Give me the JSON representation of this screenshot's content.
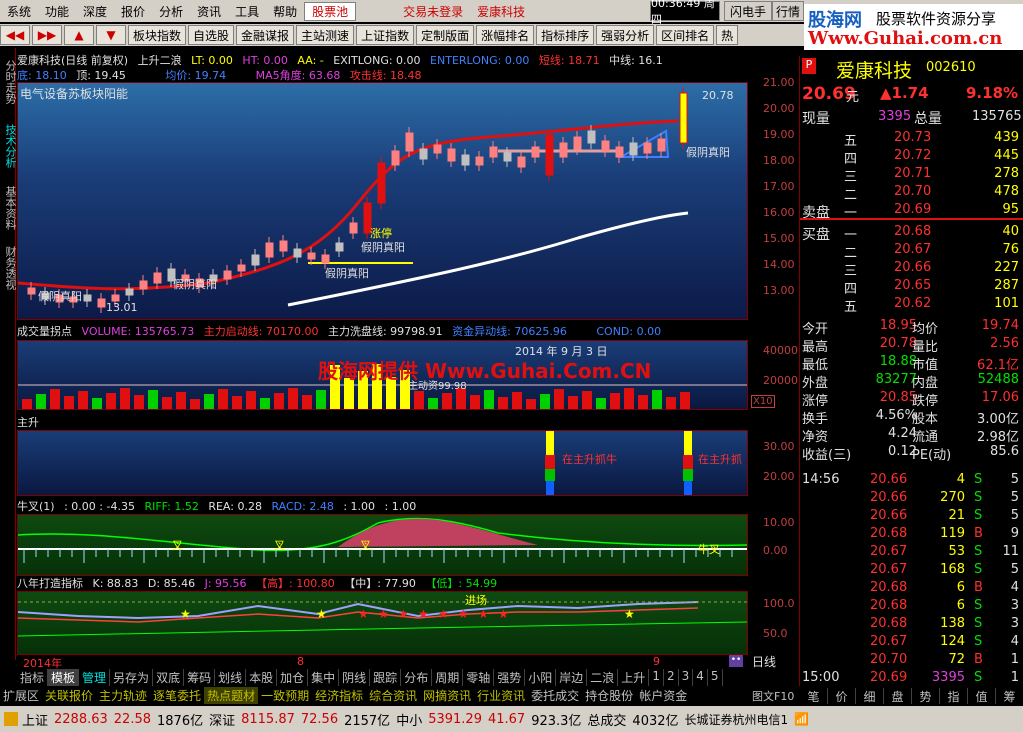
{
  "menu": [
    "系统",
    "功能",
    "深度",
    "报价",
    "分析",
    "资讯",
    "工具",
    "帮助"
  ],
  "menu_pool": "股票池",
  "menu_notice": "交易未登录",
  "menu_stock": "爱康科技",
  "clock": "00:36:49 周四",
  "flash_btn": "闪电手",
  "quote_btn": "行情",
  "logo": {
    "t1": "股海网",
    "t2": "股票软件资源分享",
    "t3": "Www.Guhai.com.cn"
  },
  "toolbar": [
    "板块指数",
    "自选股",
    "金融谋报",
    "主站测速",
    "上证指数",
    "定制版面",
    "涨幅排名",
    "指标排序",
    "强弱分析",
    "区间排名",
    "热"
  ],
  "side_tabs": [
    "分时走势",
    "技术分析",
    "基本资料",
    "财务透视"
  ],
  "main_header": {
    "title": "爱康科技(日线 前复权)",
    "f1": "上升二浪",
    "f2": "LT: 0.00",
    "f3": "HT: 0.00",
    "f4": "AA: -",
    "f5": "EXITLONG: 0.00",
    "f6": "ENTERLONG: 0.00",
    "f7": "短线: 18.71",
    "f8": "中线: 16.1"
  },
  "main_header2": {
    "low": "底: 18.10",
    "top": "顶: 19.45",
    "avg": "均价: 19.74",
    "ma5": "MA5角度: 63.68",
    "atk": "攻击线: 18.48"
  },
  "main_sub": "电气设备苏板块阳能",
  "main_labels": {
    "high": "20.78",
    "low": "13.01",
    "a1": "假阴真阳",
    "a2": "假阴真阳",
    "a3": "假阴真阳",
    "a4": "假阴真阳",
    "a5": "假阴真阳",
    "zt": "涨停"
  },
  "main_axis": [
    "21.00",
    "20.00",
    "19.00",
    "18.00",
    "17.00",
    "16.00",
    "15.00",
    "14.00",
    "13.00"
  ],
  "vol_header": {
    "name": "成交量拐点",
    "v1": "VOLUME: 135765.73",
    "v2": "主力启动线: 70170.00",
    "v3": "主力洗盘线: 99798.91",
    "v4": "资金异动线: 70625.96",
    "v5": "COND: 0.00"
  },
  "vol_axis": [
    "40000",
    "20000",
    "X10"
  ],
  "vol_watermark": "股海网提供 Www.Guhai.Com.CN",
  "vol_date": "2014 年 9 月 3 日",
  "vol_note": "主动资99.98",
  "zs_header": "主升",
  "zs_axis": [
    "30.00",
    "20.00"
  ],
  "zs_labels": [
    "在主升抓牛",
    "在主升抓"
  ],
  "nc_header": {
    "name": "牛叉(1)",
    "v1": ": 0.00 : -4.35",
    "v2": "RIFF: 1.52",
    "v3": "REA: 0.28",
    "v4": "RACD: 2.48",
    "v5": ": 1.00",
    "v6": ": 1.00"
  },
  "nc_axis": [
    "10.00",
    "0.00"
  ],
  "nc_labels": [
    "叉",
    "叉",
    "叉",
    "牛叉"
  ],
  "bn_header": {
    "name": "八年打造指标",
    "k": "K: 88.83",
    "d": "D: 85.46",
    "j": "J: 95.56",
    "g": "【高】: 100.80",
    "z": "【中】: 77.90",
    "l": "【低】: 54.99"
  },
  "bn_axis": [
    "100.0",
    "50.0"
  ],
  "bn_label": "进场",
  "timeline": {
    "y": "2014年",
    "m8": "8",
    "m9": "9"
  },
  "bottom_tabs": [
    "指标",
    "模板",
    "管理",
    "另存为",
    "双底",
    "筹码",
    "划线",
    "本股",
    "加仓",
    "集中",
    "阴线",
    "跟踪",
    "分布",
    "周期",
    "零轴",
    "强势",
    "小阳",
    "岸边",
    "二浪",
    "上升",
    "1",
    "2",
    "3",
    "4",
    "5"
  ],
  "day_btn": "日线",
  "info_tabs": [
    "扩展区",
    "关联报价",
    "主力轨迹",
    "逐笔委托",
    "热点题材",
    "一致预期",
    "经济指标",
    "综合资讯",
    "网摘资讯",
    "行业资讯",
    "委托成交",
    "持仓股份",
    "帐户资金"
  ],
  "right": {
    "code_flag": "P",
    "name": "爱康科技",
    "code": "002610",
    "price": "20.69",
    "unit": "元",
    "chg": "▲1.74",
    "pct": "9.18%",
    "now_lbl": "现量",
    "now_val": "3395",
    "total_lbl": "总量",
    "total_val": "135765",
    "sell": [
      {
        "l": "五",
        "p": "20.73",
        "v": "439"
      },
      {
        "l": "四",
        "p": "20.72",
        "v": "445"
      },
      {
        "l": "三",
        "p": "20.71",
        "v": "278"
      },
      {
        "l": "二",
        "p": "20.70",
        "v": "478"
      },
      {
        "l": "一",
        "p": "20.69",
        "v": "95"
      }
    ],
    "buy": [
      {
        "l": "一",
        "p": "20.68",
        "v": "40"
      },
      {
        "l": "二",
        "p": "20.67",
        "v": "76"
      },
      {
        "l": "三",
        "p": "20.66",
        "v": "227"
      },
      {
        "l": "四",
        "p": "20.65",
        "v": "287"
      },
      {
        "l": "五",
        "p": "20.62",
        "v": "101"
      }
    ],
    "sell_lbl": "卖盘",
    "buy_lbl": "买盘",
    "stats": [
      [
        "今开",
        "18.95",
        "均价",
        "19.74"
      ],
      [
        "最高",
        "20.78",
        "量比",
        "2.56"
      ],
      [
        "最低",
        "18.88",
        "市值",
        "62.1亿"
      ],
      [
        "外盘",
        "83277",
        "内盘",
        "52488"
      ],
      [
        "涨停",
        "20.85",
        "跌停",
        "17.06"
      ],
      [
        "换手",
        "4.56%",
        "股本",
        "3.00亿"
      ],
      [
        "净资",
        "4.24",
        "流通",
        "2.98亿"
      ],
      [
        "收益(三)",
        "0.12",
        "PE(动)",
        "85.6"
      ]
    ],
    "ticks": [
      [
        "14:56",
        "20.66",
        "4",
        "S",
        "5"
      ],
      [
        "",
        "20.66",
        "270",
        "S",
        "5"
      ],
      [
        "",
        "20.66",
        "21",
        "S",
        "5"
      ],
      [
        "",
        "20.68",
        "119",
        "B",
        "9"
      ],
      [
        "",
        "20.67",
        "53",
        "S",
        "11"
      ],
      [
        "",
        "20.67",
        "168",
        "S",
        "5"
      ],
      [
        "",
        "20.68",
        "6",
        "B",
        "4"
      ],
      [
        "",
        "20.68",
        "6",
        "S",
        "3"
      ],
      [
        "",
        "20.68",
        "138",
        "S",
        "3"
      ],
      [
        "",
        "20.67",
        "124",
        "S",
        "4"
      ],
      [
        "",
        "20.70",
        "72",
        "B",
        "1"
      ],
      [
        "15:00",
        "20.69",
        "3395",
        "S",
        "1"
      ]
    ],
    "btabs": [
      "笔",
      "价",
      "细",
      "盘",
      "势",
      "指",
      "值",
      "筹"
    ]
  },
  "status": {
    "sh_lbl": "上证",
    "sh": "2288.63",
    "sh_chg": "22.58",
    "sh_amt": "1876亿",
    "sz_lbl": "深证",
    "sz": "8115.87",
    "sz_chg": "72.56",
    "sz_amt": "2157亿",
    "zx_lbl": "中小",
    "zx": "5391.29",
    "zx_chg": "41.67",
    "zx_amt": "923.3亿",
    "tot_lbl": "总成交",
    "tot": "4032亿",
    "broker": "长城证券杭州电信1"
  },
  "chart_data": {
    "type": "candlestick",
    "title": "爱康科技(日线 前复权)",
    "high": 20.78,
    "low": 13.01,
    "ylim": [
      12.6,
      21.5
    ]
  }
}
